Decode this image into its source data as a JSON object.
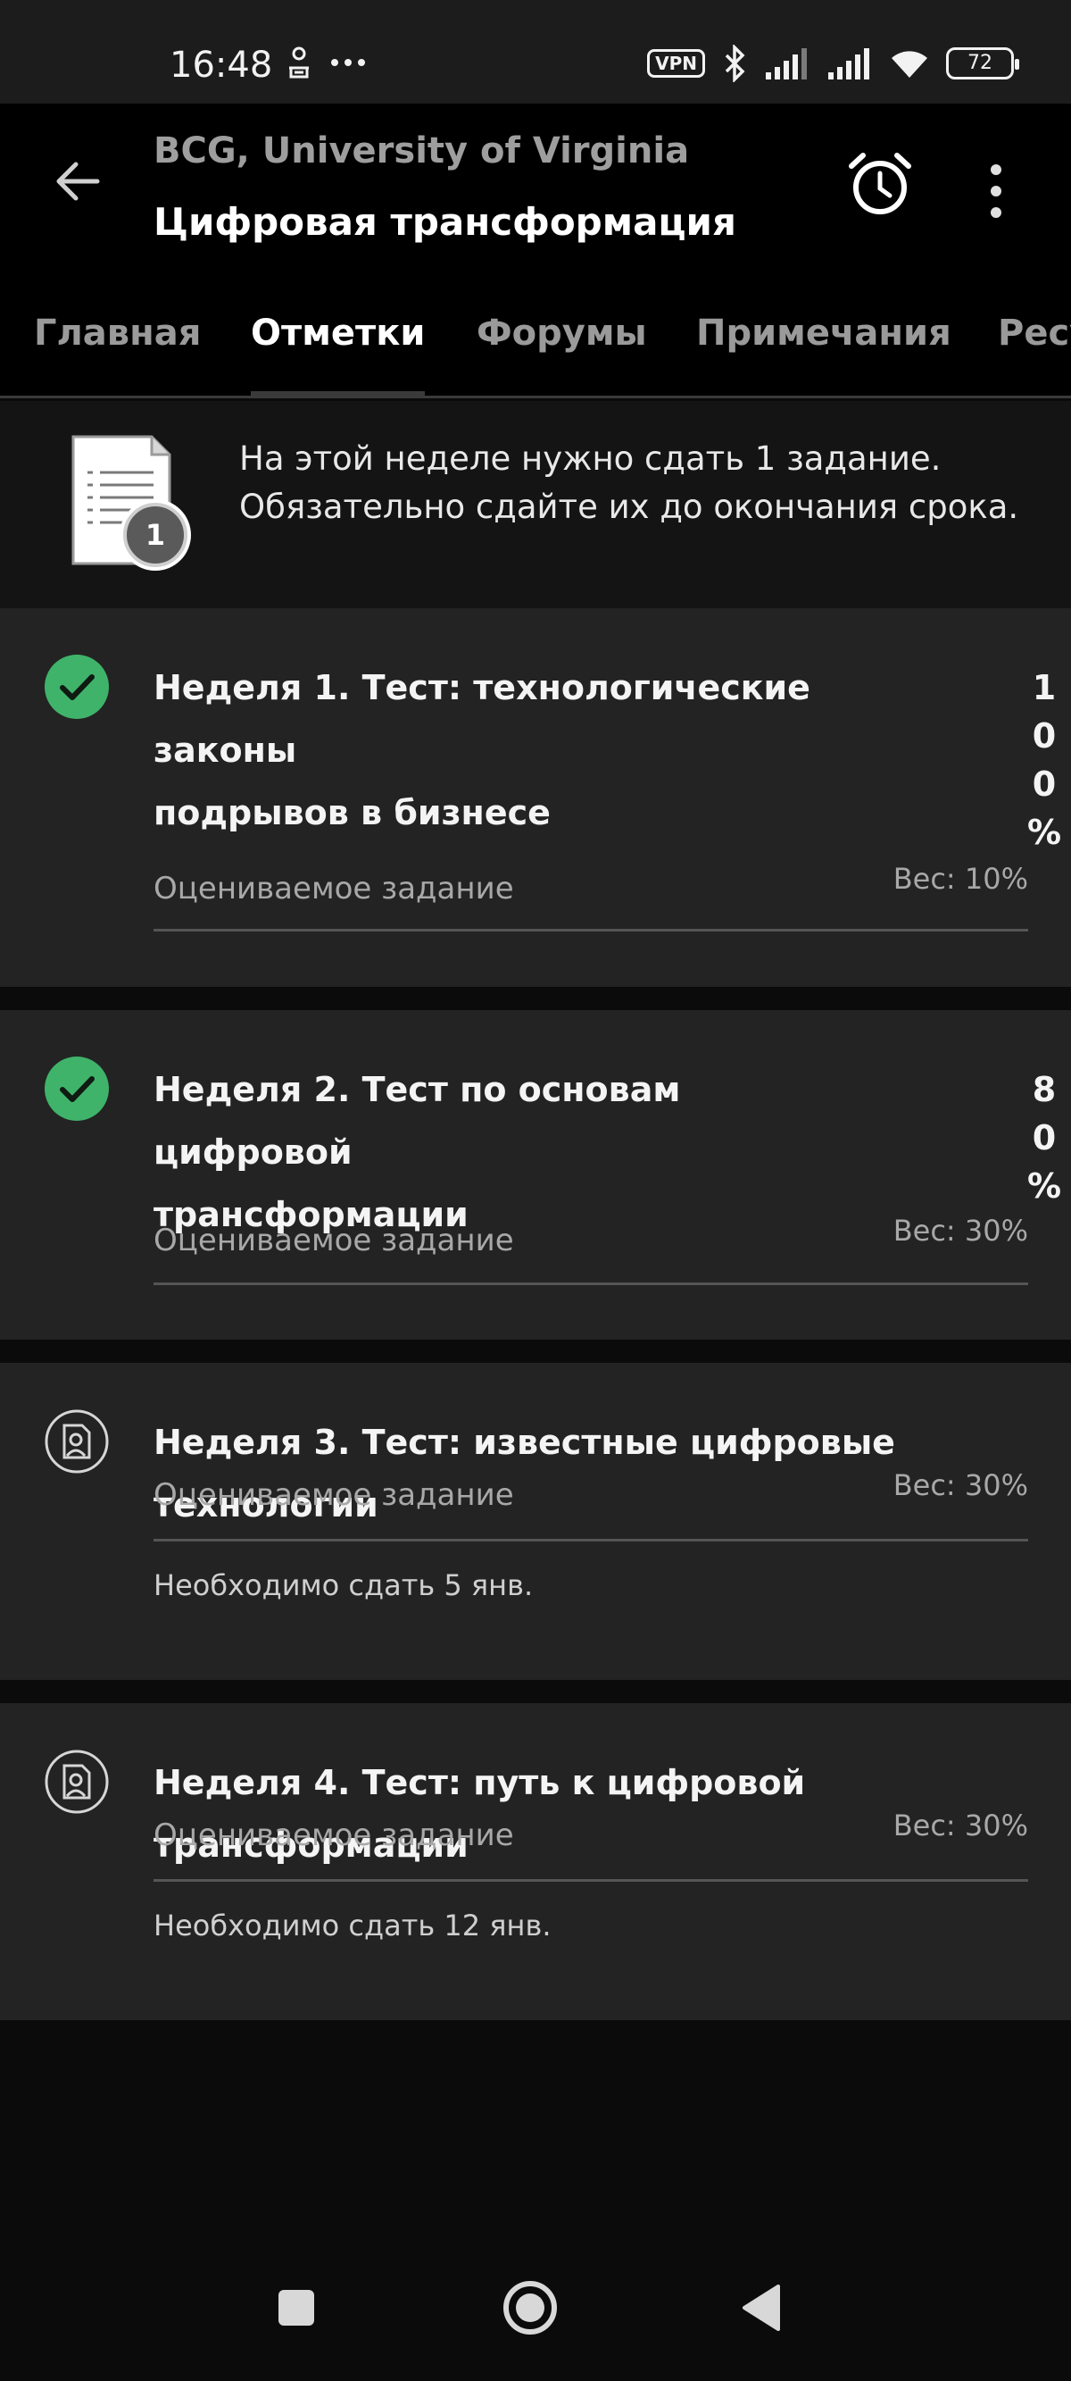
{
  "status_bar": {
    "time": "16:48",
    "vpn_label": "VPN",
    "battery": "72",
    "icons": [
      "person-pin-icon",
      "more-dots-icon",
      "bluetooth-icon",
      "signal-icon",
      "signal-icon",
      "wifi-icon"
    ]
  },
  "app_bar": {
    "subtitle": "BCG, University of Virginia",
    "title": "Цифровая трансформация"
  },
  "tabs": [
    {
      "label": "Главная"
    },
    {
      "label": "Отметки"
    },
    {
      "label": "Форумы"
    },
    {
      "label": "Примечания"
    },
    {
      "label": "Ресу"
    }
  ],
  "notice": {
    "badge_count": "1",
    "line1": "На этой неделе нужно сдать 1 задание.",
    "line2": "Обязательно сдайте их до окончания срока."
  },
  "assignments": [
    {
      "name_line1": "Неделя 1. Тест: технологические законы",
      "name_line2": "подрывов в бизнесе",
      "grade_chars": [
        "1",
        "0",
        "0",
        "%"
      ],
      "kind": "Оцениваемое задание",
      "weight": "Вес: 10%",
      "status": "completed"
    },
    {
      "name_line1": "Неделя 2. Тест по основам цифровой",
      "name_line2": "трансформации",
      "grade_chars": [
        "8",
        "0",
        "%"
      ],
      "kind": "Оцениваемое задание",
      "weight": "Вес: 30%",
      "status": "completed"
    },
    {
      "name_line1": "Неделя 3. Тест: известные цифровые технологии",
      "kind": "Оцениваемое задание",
      "weight": "Вес: 30%",
      "due": "Необходимо сдать 5 янв.",
      "status": "pending"
    },
    {
      "name_line1": "Неделя 4. Тест: путь к цифровой трансформации",
      "kind": "Оцениваемое задание",
      "weight": "Вес: 30%",
      "due": "Необходимо сдать 12 янв.",
      "status": "pending"
    }
  ],
  "colors": {
    "success_green": "#3fb36a",
    "card_bg": "#232323",
    "page_bg": "#0b0b0b"
  }
}
